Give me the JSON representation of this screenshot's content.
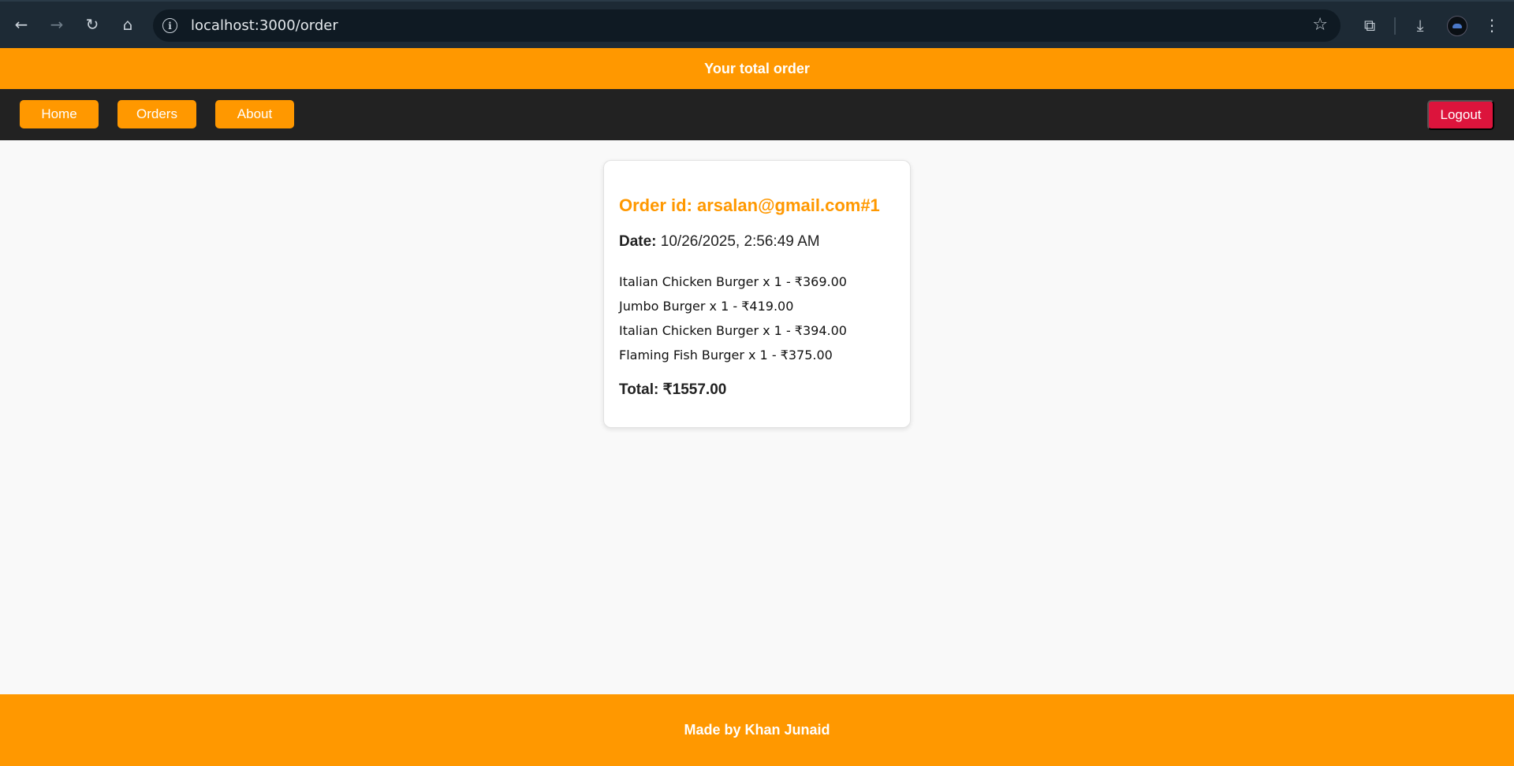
{
  "browser": {
    "url": "localhost:3000/order",
    "icons": {
      "back": "back-arrow-icon",
      "forward": "forward-arrow-icon",
      "reload": "reload-icon",
      "home": "home-icon",
      "site_info": "info-icon",
      "bookmark": "star-icon",
      "extensions": "puzzle-icon",
      "downloads": "download-icon",
      "menu": "kebab-menu-icon"
    }
  },
  "header": {
    "title": "Your total order"
  },
  "navbar": {
    "home": "Home",
    "orders": "Orders",
    "about": "About",
    "logout": "Logout"
  },
  "order": {
    "id_label": "Order id: arsalan@gmail.com#1",
    "date_label": "Date:",
    "date_value": "10/26/2025, 2:56:49 AM",
    "items": [
      "Italian Chicken Burger x 1 - ₹369.00",
      "Jumbo Burger x 1 - ₹419.00",
      "Italian Chicken Burger x 1 - ₹394.00",
      "Flaming Fish Burger x 1 - ₹375.00"
    ],
    "total": "Total: ₹1557.00"
  },
  "footer": {
    "prefix": "Made by",
    "author": "Khan Junaid"
  },
  "colors": {
    "accent": "#ff9800",
    "navbar": "#222222",
    "logout": "#dc143c",
    "background": "#f9f9f9"
  }
}
